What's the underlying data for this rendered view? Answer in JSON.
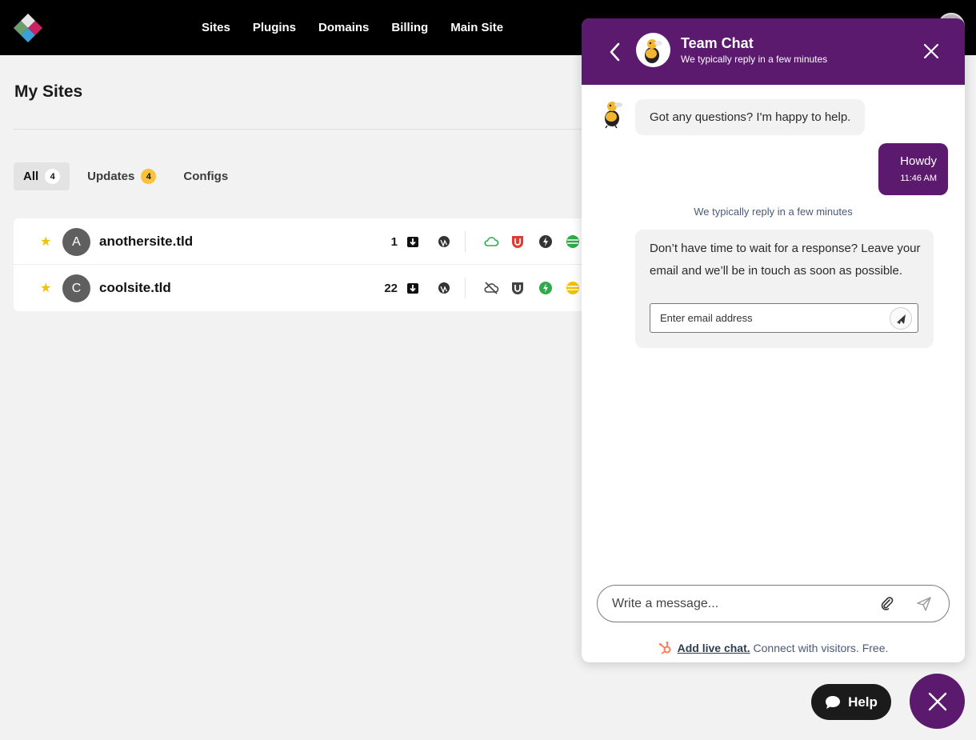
{
  "nav": {
    "items": [
      {
        "label": "Sites"
      },
      {
        "label": "Plugins"
      },
      {
        "label": "Domains"
      },
      {
        "label": "Billing"
      },
      {
        "label": "Main Site"
      }
    ]
  },
  "page": {
    "title": "My Sites"
  },
  "tabs": [
    {
      "label": "All",
      "count": "4"
    },
    {
      "label": "Updates",
      "count": "4"
    },
    {
      "label": "Configs"
    }
  ],
  "sites": [
    {
      "initial": "A",
      "name": "anothersite.tld",
      "updates": "1"
    },
    {
      "initial": "C",
      "name": "coolsite.tld",
      "updates": "22"
    }
  ],
  "chat": {
    "title": "Team Chat",
    "subtitle": "We typically reply in a few minutes",
    "bot_message": "Got any questions? I'm happy to help.",
    "user_message": "Howdy",
    "user_time": "11:46 AM",
    "reply_note": "We typically reply in a few minutes",
    "email_prompt": "Don’t have time to wait for a response? Leave your email and we’ll be in touch as soon as possible.",
    "email_placeholder": "Enter email address",
    "composer_placeholder": "Write a message...",
    "footer_link": "Add live chat.",
    "footer_text": " Connect with visitors. Free."
  },
  "help": {
    "label": "Help"
  },
  "colors": {
    "brand": "#5c1a6e",
    "badge": "#f9c23c",
    "star": "#f2c200"
  }
}
